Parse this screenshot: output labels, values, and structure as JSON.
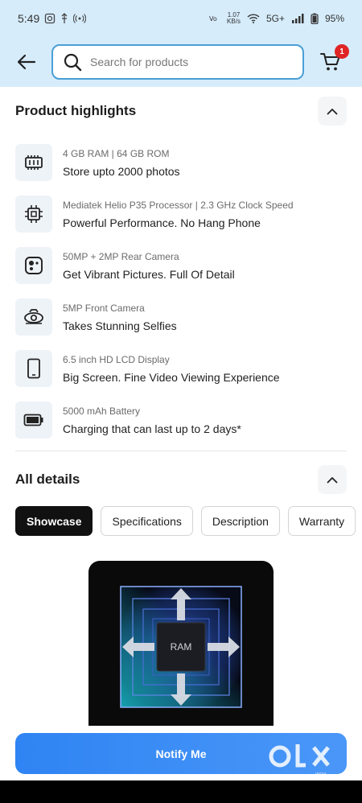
{
  "status_bar": {
    "time": "5:49",
    "net_speed_value": "1.07",
    "net_speed_unit": "KB/s",
    "network": "5G+",
    "battery": "95%"
  },
  "header": {
    "search_placeholder": "Search for products",
    "cart_count": "1"
  },
  "highlights": {
    "title": "Product highlights",
    "items": [
      {
        "sub": "4 GB RAM | 64 GB ROM",
        "main": "Store upto 2000 photos",
        "icon": "memory-chip-icon"
      },
      {
        "sub": "Mediatek Helio P35 Processor | 2.3 GHz Clock Speed",
        "main": "Powerful Performance. No Hang Phone",
        "icon": "processor-icon"
      },
      {
        "sub": "50MP + 2MP Rear Camera",
        "main": "Get Vibrant Pictures. Full Of Detail",
        "icon": "rear-camera-icon"
      },
      {
        "sub": "5MP Front Camera",
        "main": "Takes Stunning Selfies",
        "icon": "front-camera-icon"
      },
      {
        "sub": "6.5 inch HD LCD Display",
        "main": "Big Screen. Fine Video Viewing Experience",
        "icon": "display-icon"
      },
      {
        "sub": "5000 mAh Battery",
        "main": "Charging that can last up to 2 days*",
        "icon": "battery-icon"
      }
    ]
  },
  "details": {
    "title": "All details",
    "tabs": [
      "Showcase",
      "Specifications",
      "Description",
      "Warranty"
    ],
    "active_tab": "Showcase",
    "showcase_label": "RAM"
  },
  "notify_label": "Notify Me",
  "watermark": {
    "brand": "OLX",
    "sub": "INDIA"
  },
  "colors": {
    "header_bg": "#d6ecfb",
    "search_border": "#4a9fd6",
    "badge": "#e02424",
    "notify_button": "#3b8ef5",
    "active_tab": "#111111"
  }
}
